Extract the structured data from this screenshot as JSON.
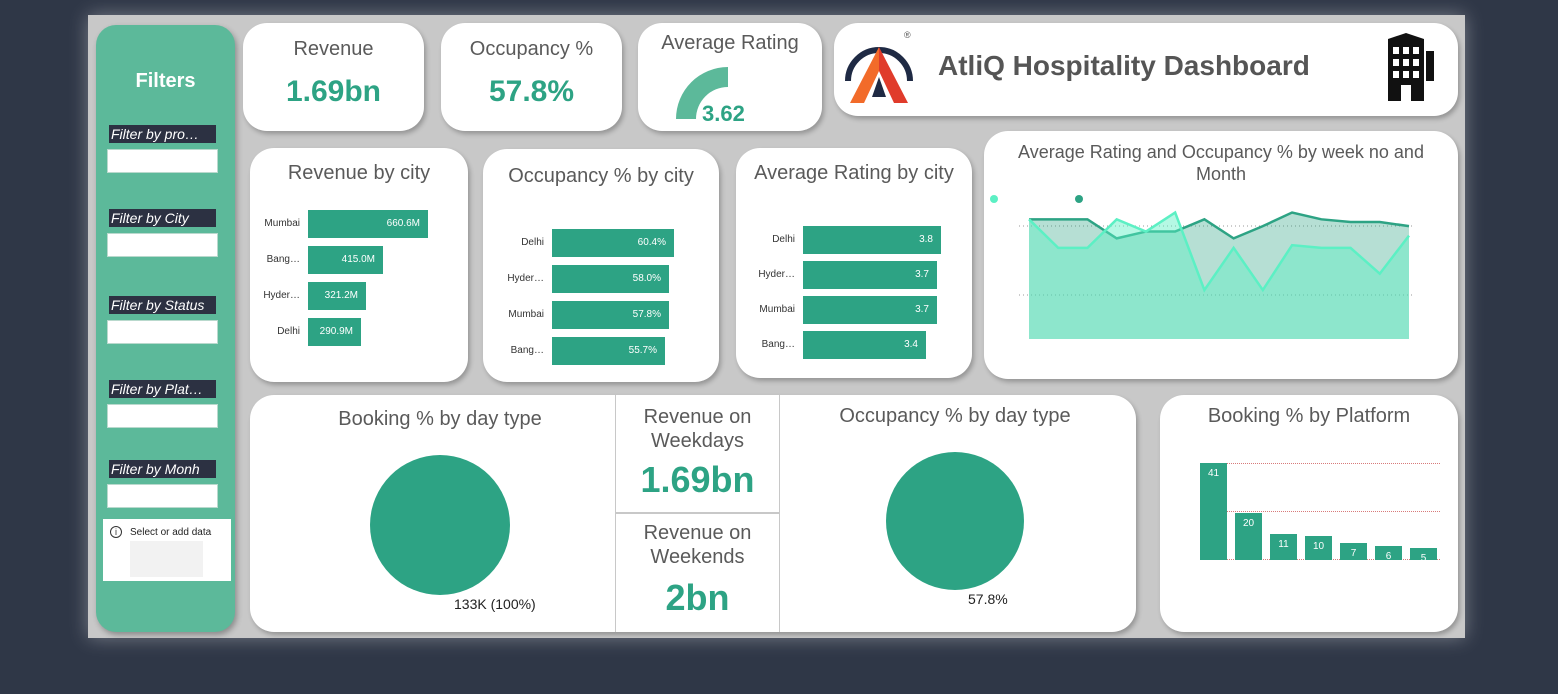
{
  "kpis": {
    "revenue": {
      "label": "Revenue",
      "value": "1.69bn"
    },
    "occupancy": {
      "label": "Occupancy %",
      "value": "57.8%"
    },
    "rating": {
      "label": "Average Rating",
      "value": "3.62",
      "gauge_fraction": 0.72
    }
  },
  "header": {
    "title": "AtliQ Hospitality Dashboard",
    "logo_mark": "®"
  },
  "filters": {
    "title": "Filters",
    "slicers": [
      {
        "label": "Filter by pro…"
      },
      {
        "label": "Filter by City"
      },
      {
        "label": "Filter by Status"
      },
      {
        "label": "Filter by Plat…"
      },
      {
        "label": "Filter by Monh"
      }
    ],
    "select_data": "Select or add data"
  },
  "revenue_city": {
    "title": "Revenue by city",
    "chart_data": {
      "type": "bar",
      "categories": [
        "Mumbai",
        "Bang…",
        "Hyder…",
        "Delhi"
      ],
      "values": [
        660.6,
        415.0,
        321.2,
        290.9
      ],
      "labels": [
        "660.6M",
        "415.0M",
        "321.2M",
        "290.9M"
      ]
    }
  },
  "occupancy_city": {
    "title": "Occupancy % by city",
    "chart_data": {
      "type": "bar",
      "categories": [
        "Delhi",
        "Hyder…",
        "Mumbai",
        "Bang…"
      ],
      "values": [
        60.4,
        58.0,
        57.8,
        55.7
      ],
      "labels": [
        "60.4%",
        "58.0%",
        "57.8%",
        "55.7%"
      ]
    }
  },
  "rating_city": {
    "title": "Average Rating by city",
    "chart_data": {
      "type": "bar",
      "categories": [
        "Delhi",
        "Hyder…",
        "Mumbai",
        "Bang…"
      ],
      "values": [
        3.8,
        3.7,
        3.7,
        3.4
      ],
      "labels": [
        "3.8",
        "3.7",
        "3.7",
        "3.4"
      ]
    }
  },
  "weekly": {
    "title": "Average Rating and Occupancy % by week no and Month",
    "chart_data": {
      "type": "area",
      "series": [
        {
          "values": [
            0.88,
            0.88,
            0.88,
            0.74,
            0.79,
            0.79,
            0.88,
            0.74,
            0.83,
            0.93,
            0.88,
            0.86,
            0.86,
            0.83
          ]
        },
        {
          "values": [
            0.88,
            0.67,
            0.67,
            0.88,
            0.79,
            0.93,
            0.36,
            0.67,
            0.36,
            0.69,
            0.67,
            0.67,
            0.48,
            0.76
          ]
        }
      ],
      "colors": [
        "#2da384",
        "#5cf0c4"
      ]
    }
  },
  "booking_daytype": {
    "title": "Booking % by day type",
    "label": "133K (100%)",
    "chart_data": {
      "type": "pie",
      "values": [
        100
      ]
    }
  },
  "weekday": {
    "label": "Revenue on Weekdays",
    "value": "1.69bn"
  },
  "weekend": {
    "label": "Revenue on Weekends",
    "value": "2bn"
  },
  "occupancy_daytype": {
    "title": "Occupancy % by day type",
    "label": "57.8%",
    "chart_data": {
      "type": "pie",
      "values": [
        57.8
      ]
    }
  },
  "platform": {
    "title": "Booking % by Platform",
    "chart_data": {
      "type": "bar",
      "values": [
        41,
        20,
        11,
        10,
        7,
        6,
        5
      ],
      "labels": [
        "41",
        "20",
        "11",
        "10",
        "7",
        "6",
        "5"
      ]
    }
  },
  "colors": {
    "accent": "#2da384",
    "filter_pane": "#5cb99a",
    "background": "#2f3747"
  }
}
